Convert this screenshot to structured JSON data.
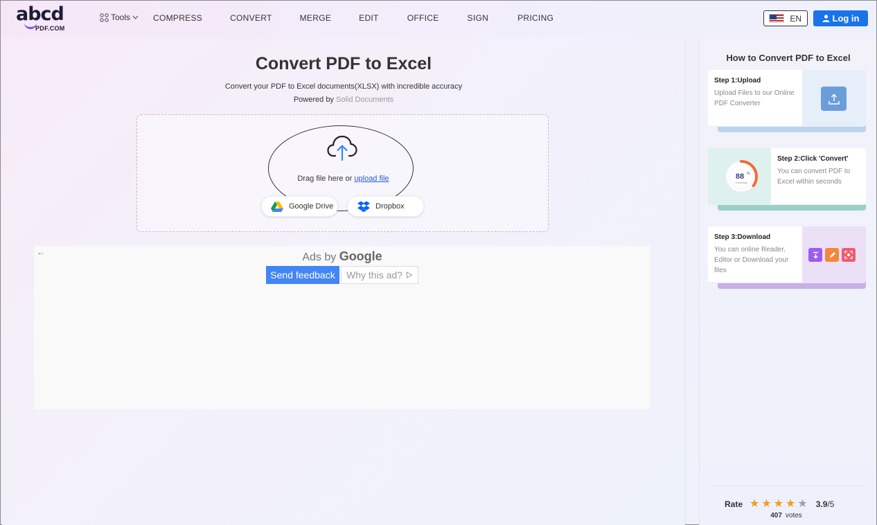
{
  "header": {
    "logo_main": "abcd",
    "logo_sub": "PDF.COM",
    "tools_label": "Tools",
    "nav": [
      "COMPRESS",
      "CONVERT",
      "MERGE",
      "EDIT",
      "OFFICE",
      "SIGN",
      "PRICING"
    ],
    "language": "EN",
    "login_label": "Log in"
  },
  "main": {
    "title": "Convert PDF to Excel",
    "subtitle": "Convert your PDF to Excel documents(XLSX) with incredible accuracy",
    "powered_prefix": "Powered by",
    "powered_link": "Solid Documents",
    "drag_text": "Drag file here or",
    "upload_link": "upload file",
    "google_drive_label": "Google Drive",
    "dropbox_label": "Dropbox"
  },
  "ad": {
    "ads_by": "Ads by",
    "google": "Google",
    "send_feedback": "Send feedback",
    "why_this_ad": "Why this ad?"
  },
  "sidebar": {
    "title": "How to Convert PDF to Excel",
    "steps": [
      {
        "heading": "Step 1:Upload",
        "desc": "Upload Files to our Online PDF Converter"
      },
      {
        "heading": "Step 2:Click 'Convert'",
        "desc": "You can convert PDF to Excel within seconds"
      },
      {
        "heading": "Step 3:Download",
        "desc": "You can online Reader, Editor or Download your files"
      }
    ],
    "gauge_value": "88",
    "gauge_unit": "%",
    "gauge_label": "Converting",
    "rate_label": "Rate",
    "rating_value": "3.9",
    "rating_max": "/5",
    "rating_stars_filled": 4,
    "votes_count": "407",
    "votes_label": "votes"
  },
  "colors": {
    "primary": "#1a73e8",
    "feedback_blue": "#4285f4",
    "star": "#f59a1d",
    "gauge": "#f06a3c"
  }
}
